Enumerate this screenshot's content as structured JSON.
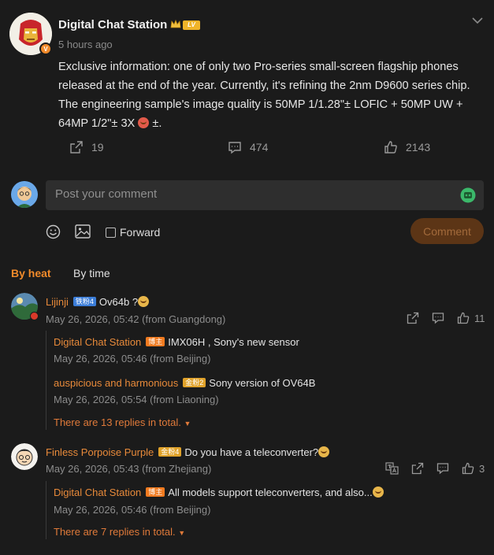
{
  "post": {
    "author": "Digital Chat Station",
    "time": "5 hours ago",
    "level_badge": "LV",
    "body": "Exclusive information: one of only two Pro-series small-screen flagship phones released at the end of the year. Currently, it's refining the 2nm D9600 series chip. The engineering sample's image quality is 50MP 1/1.28\"± LOFIC + 50MP UW + 64MP 1/2\"± 3X",
    "body_tail": "±.",
    "reposts": "19",
    "comments": "474",
    "likes": "2143"
  },
  "composer": {
    "placeholder": "Post your comment",
    "forward_label": "Forward",
    "submit_label": "Comment"
  },
  "tabs": {
    "by_heat": "By heat",
    "by_time": "By time"
  },
  "comments": [
    {
      "name": "Lijinji",
      "badge": "铁粉4",
      "text": "Ov64b  ?",
      "time": "May 26, 2026, 05:42 (from Guangdong)",
      "likes": "11",
      "replies": [
        {
          "name": "Digital Chat Station",
          "badge": "博主",
          "text": "IMX06H  , Sony's new sensor",
          "time": "May 26, 2026, 05:46 (from Beijing)"
        },
        {
          "name": "auspicious and harmonious",
          "badge": "金粉2",
          "text": "Sony  version of OV64B",
          "time": "May 26, 2026, 05:54 (from Liaoning)"
        }
      ],
      "more": "There are 13 replies in total."
    },
    {
      "name": "Finless Porpoise Purple",
      "badge": "金粉4",
      "text": "Do  you have a teleconverter?",
      "time": "May 26, 2026, 05:43 (from Zhejiang)",
      "likes": "3",
      "replies": [
        {
          "name": "Digital Chat Station",
          "badge": "博主",
          "text": "All  models support teleconverters, and also...",
          "time": "May 26, 2026, 05:46 (from Beijing)"
        }
      ],
      "more": "There are 7 replies in total."
    }
  ],
  "colors": {
    "accent": "#f08a2a",
    "background": "#1b1b1b",
    "input_bg": "#2e2e2e"
  }
}
